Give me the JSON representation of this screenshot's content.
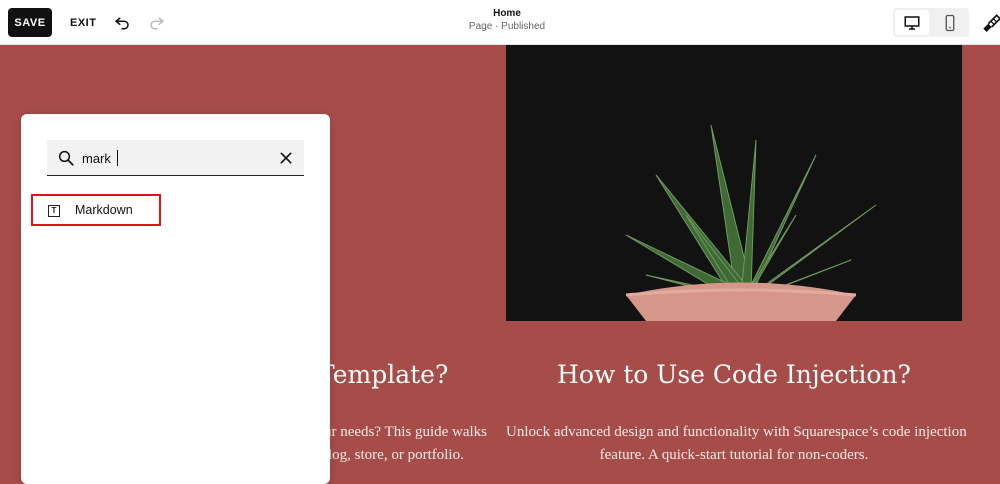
{
  "toolbar": {
    "save_label": "SAVE",
    "exit_label": "EXIT",
    "page_title": "Home",
    "page_status": "Page · Published",
    "icons": {
      "undo": "undo-icon",
      "redo": "redo-icon",
      "desktop": "desktop-icon",
      "mobile": "mobile-icon",
      "design": "paintbrush-icon"
    }
  },
  "canvas": {
    "left_heading": "Template?",
    "left_body": [
      "ur needs? This guide walks",
      "log, store, or portfolio."
    ],
    "right_heading": "How to Use Code Injection?",
    "right_body": [
      "Unlock advanced design and functionality with Squarespace’s code injection",
      "feature. A quick-start tutorial for non-coders."
    ],
    "background_color": "#a64d4a"
  },
  "block_picker": {
    "search_value": "mark",
    "results": [
      {
        "label": "Markdown",
        "icon": "text-block-icon"
      }
    ],
    "highlight_color": "#e0121a"
  }
}
